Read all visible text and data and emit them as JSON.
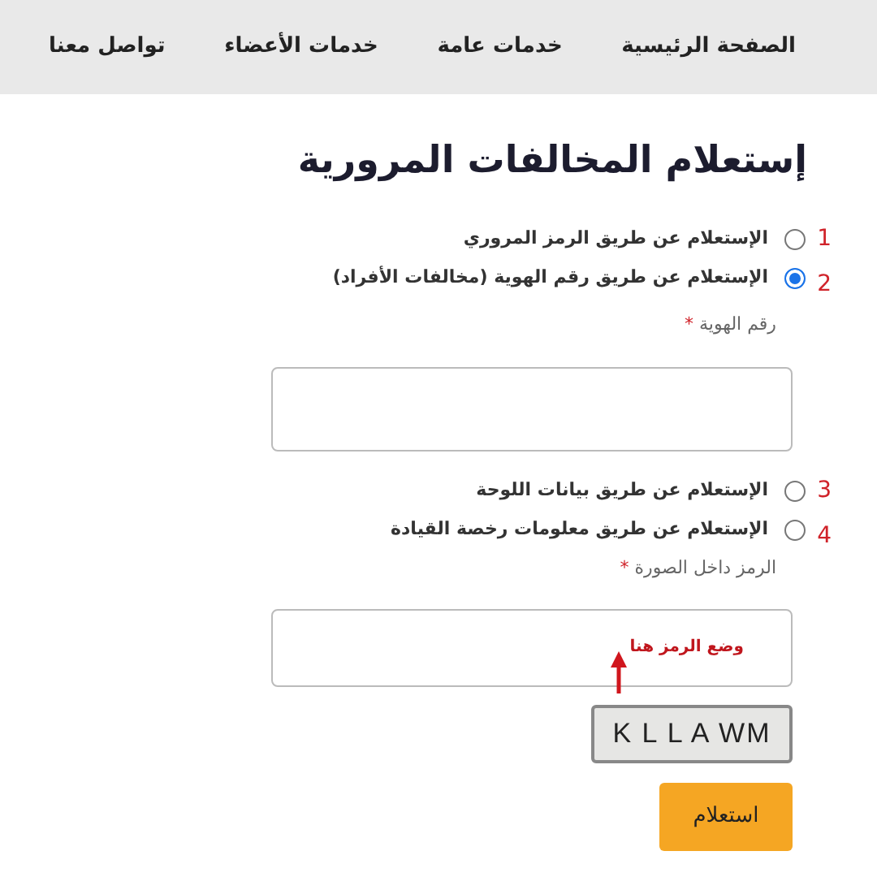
{
  "nav": [
    {
      "label": "الصفحة الرئيسية"
    },
    {
      "label": "خدمات عامة"
    },
    {
      "label": "خدمات الأعضاء"
    },
    {
      "label": "تواصل معنا"
    }
  ],
  "title": "إستعلام المخالفات المرورية",
  "options": [
    {
      "number": "1",
      "label": "الإستعلام عن طريق الرمز المروري",
      "selected": false
    },
    {
      "number": "2",
      "label": "الإستعلام عن طريق رقم الهوية (مخالفات الأفراد)",
      "selected": true
    }
  ],
  "id_field": {
    "label": "رقم الهوية",
    "required_mark": "*"
  },
  "options_2": [
    {
      "number": "3",
      "label": "الإستعلام عن طريق بيانات اللوحة",
      "selected": false
    },
    {
      "number": "4",
      "label": "الإستعلام عن طريق معلومات رخصة القيادة",
      "selected": false
    }
  ],
  "captcha_field": {
    "label": "الرمز داخل الصورة",
    "required_mark": "*",
    "annotation": "وضع الرمز هنا"
  },
  "captcha": {
    "text": "K L L A WM"
  },
  "submit": "استعلام"
}
